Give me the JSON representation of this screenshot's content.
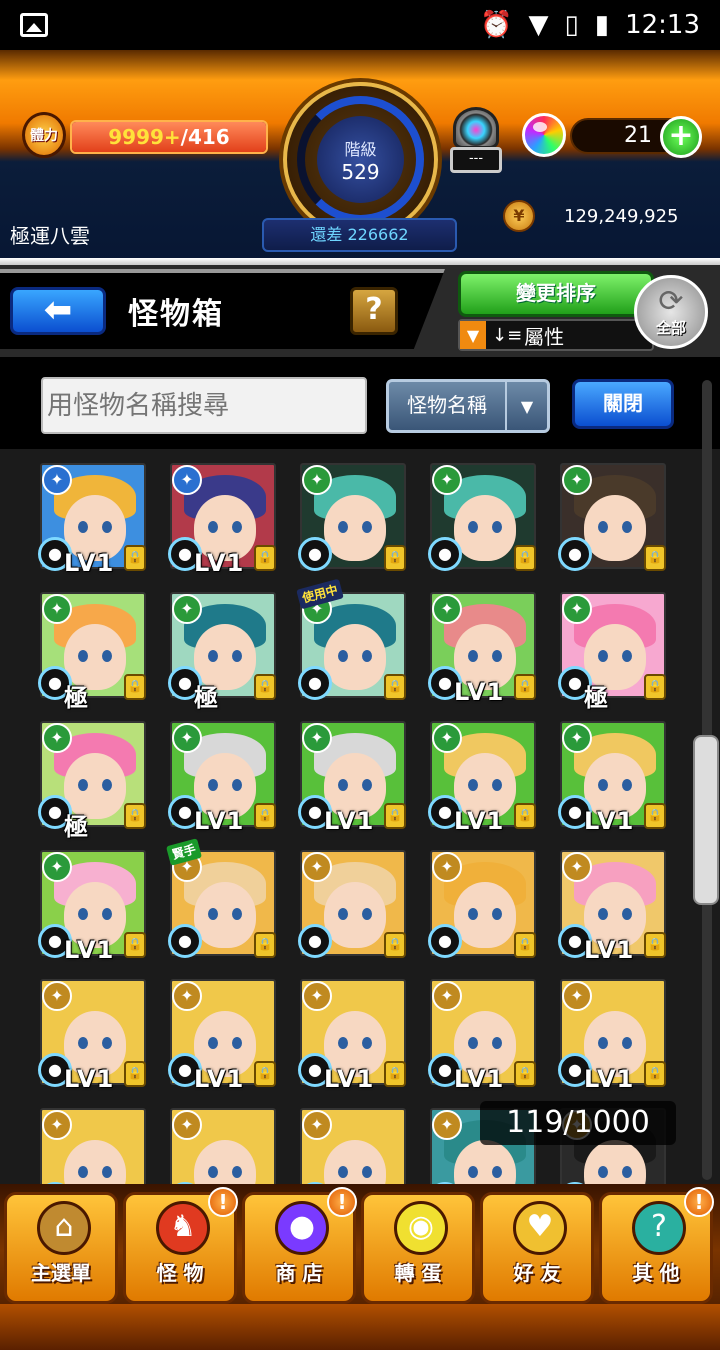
{
  "status_bar": {
    "time": "12:13"
  },
  "player": {
    "stamina_label": "體力",
    "stamina_current": "9999+",
    "stamina_max": "/416",
    "rank_label": "階級",
    "rank": "529",
    "rank_to_next": "還差 226662",
    "name": "極運八雲",
    "orb_count": "21",
    "gold": "129,249,925",
    "egg_panel": "---",
    "add_label": "+"
  },
  "header": {
    "title": "怪物箱",
    "back_label": "⬅",
    "help_label": "?",
    "sort_label": "變更排序",
    "sort_by": "屬性",
    "all_label": "全部"
  },
  "search": {
    "placeholder": "用怪物名稱搜尋",
    "mode": "怪物名稱",
    "close_label": "關閉"
  },
  "box_counter": "119/1000",
  "monsters": [
    {
      "level": "LV1",
      "bg": "#3d8fe0",
      "hair": "#f0b53a",
      "elem": "#2a70d0",
      "tag": ""
    },
    {
      "level": "LV1",
      "bg": "#b23a4a",
      "hair": "#3a3a8a",
      "elem": "#2a70d0",
      "tag": ""
    },
    {
      "level": "",
      "bg": "#1f3a2f",
      "hair": "#4ab9a8",
      "elem": "#2a9a3a",
      "tag": ""
    },
    {
      "level": "",
      "bg": "#1f3a2f",
      "hair": "#4ab9a8",
      "elem": "#2a9a3a",
      "tag": ""
    },
    {
      "level": "",
      "bg": "#3a2f2a",
      "hair": "#4a3a2a",
      "elem": "#2a9a3a",
      "tag": ""
    },
    {
      "level": "極",
      "bg": "#a6e07a",
      "hair": "#f7a84a",
      "elem": "#2a9a3a",
      "tag": ""
    },
    {
      "level": "極",
      "bg": "#9fd8c0",
      "hair": "#1f7a8a",
      "elem": "#2a9a3a",
      "tag": ""
    },
    {
      "level": "",
      "bg": "#9fd8c0",
      "hair": "#1f7a8a",
      "elem": "#2a9a3a",
      "tag": "使用中"
    },
    {
      "level": "LV1",
      "bg": "#7acf5a",
      "hair": "#e88a8a",
      "elem": "#2a9a3a",
      "tag": ""
    },
    {
      "level": "極",
      "bg": "#f7a8d0",
      "hair": "#f47ab0",
      "elem": "#2a9a3a",
      "tag": ""
    },
    {
      "level": "極",
      "bg": "#b8e07a",
      "hair": "#f47ab0",
      "elem": "#2a9a3a",
      "tag": ""
    },
    {
      "level": "LV1",
      "bg": "#58c03a",
      "hair": "#d8d8d8",
      "elem": "#2a9a3a",
      "tag": ""
    },
    {
      "level": "LV1",
      "bg": "#58c03a",
      "hair": "#d8d8d8",
      "elem": "#2a9a3a",
      "tag": ""
    },
    {
      "level": "LV1",
      "bg": "#58c03a",
      "hair": "#f0c860",
      "elem": "#2a9a3a",
      "tag": ""
    },
    {
      "level": "LV1",
      "bg": "#58c03a",
      "hair": "#f0c860",
      "elem": "#2a9a3a",
      "tag": ""
    },
    {
      "level": "LV1",
      "bg": "#8ad04a",
      "hair": "#f7b0d0",
      "elem": "#2a9a3a",
      "tag": ""
    },
    {
      "level": "",
      "bg": "#f0b84a",
      "hair": "#f0d09a",
      "elem": "#c08a20",
      "tag": "賢手"
    },
    {
      "level": "",
      "bg": "#f0b84a",
      "hair": "#f0d09a",
      "elem": "#c08a20",
      "tag": ""
    },
    {
      "level": "",
      "bg": "#f0b84a",
      "hair": "#f0b03a",
      "elem": "#c08a20",
      "tag": ""
    },
    {
      "level": "LV1",
      "bg": "#f0c86a",
      "hair": "#f7a0c0",
      "elem": "#c08a20",
      "tag": ""
    },
    {
      "level": "LV1",
      "bg": "#f0c84a",
      "hair": "#f0c84a",
      "elem": "#c08a20",
      "tag": ""
    },
    {
      "level": "LV1",
      "bg": "#f0c84a",
      "hair": "#f0c84a",
      "elem": "#c08a20",
      "tag": ""
    },
    {
      "level": "LV1",
      "bg": "#f0c84a",
      "hair": "#f0c84a",
      "elem": "#c08a20",
      "tag": ""
    },
    {
      "level": "LV1",
      "bg": "#f0c84a",
      "hair": "#f0c84a",
      "elem": "#c08a20",
      "tag": ""
    },
    {
      "level": "LV1",
      "bg": "#f0c84a",
      "hair": "#f0c84a",
      "elem": "#c08a20",
      "tag": ""
    },
    {
      "level": "",
      "bg": "#f0c84a",
      "hair": "#f0c84a",
      "elem": "#c08a20",
      "tag": ""
    },
    {
      "level": "",
      "bg": "#f0c84a",
      "hair": "#f0c84a",
      "elem": "#c08a20",
      "tag": ""
    },
    {
      "level": "",
      "bg": "#f0c84a",
      "hair": "#f0c84a",
      "elem": "#c08a20",
      "tag": ""
    },
    {
      "level": "",
      "bg": "#3a9aa0",
      "hair": "#2a8a8a",
      "elem": "#c08a20",
      "tag": ""
    },
    {
      "level": "",
      "bg": "#2a2a2a",
      "hair": "#1a1a1a",
      "elem": "#c08a20",
      "tag": ""
    }
  ],
  "nav": [
    {
      "label": "主選單",
      "icon": "main-menu-icon",
      "badge": ""
    },
    {
      "label": "怪 物",
      "icon": "monster-icon",
      "badge": "!"
    },
    {
      "label": "商 店",
      "icon": "orb-shop-icon",
      "badge": "!"
    },
    {
      "label": "轉 蛋",
      "icon": "gacha-egg-icon",
      "badge": ""
    },
    {
      "label": "好 友",
      "icon": "friends-icon",
      "badge": ""
    },
    {
      "label": "其 他",
      "icon": "other-icon",
      "badge": "!"
    }
  ]
}
